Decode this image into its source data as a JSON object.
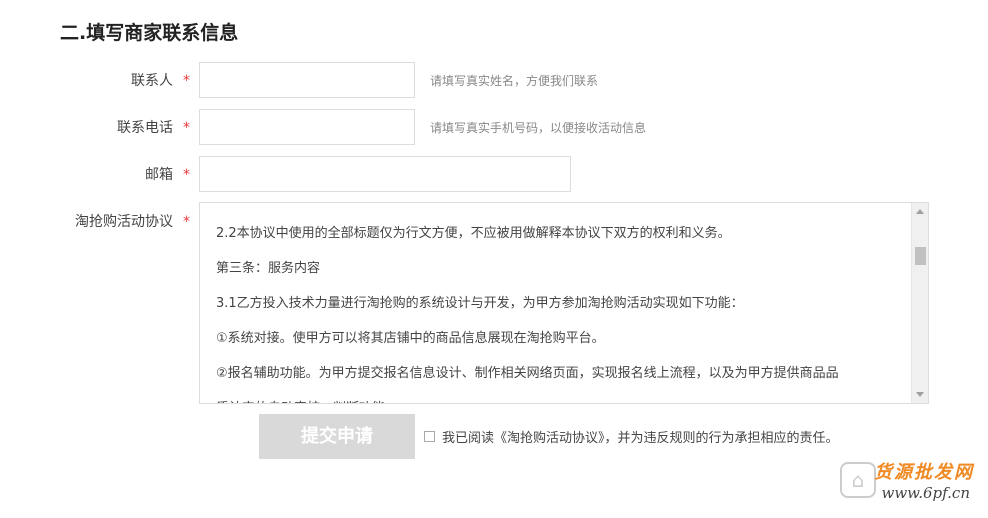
{
  "section": {
    "title": "二.填写商家联系信息"
  },
  "fields": {
    "contact": {
      "label": "联系人",
      "required": "*",
      "value": "",
      "placeholder": "",
      "hint": "请填写真实姓名，方便我们联系"
    },
    "phone": {
      "label": "联系电话",
      "required": "*",
      "value": "",
      "placeholder": "",
      "hint": "请填写真实手机号码，以便接收活动信息"
    },
    "email": {
      "label": "邮箱",
      "required": "*",
      "value": "",
      "placeholder": ""
    },
    "agreement": {
      "label": "淘抢购活动协议",
      "required": "*",
      "paragraphs": [
        "2.2本协议中使用的全部标题仅为行文方便，不应被用做解释本协议下双方的权利和义务。",
        "第三条：服务内容",
        "3.1乙方投入技术力量进行淘抢购的系统设计与开发，为甲方参加淘抢购活动实现如下功能：",
        "①系统对接。使甲方可以将其店铺中的商品信息展现在淘抢购平台。",
        "②报名辅助功能。为甲方提交报名信息设计、制作相关网络页面，实现报名线上流程，以及为甲方提供商品品",
        "质认定的自动审核、判断功能。"
      ]
    }
  },
  "actions": {
    "submit_label": "提交申请",
    "consent_text": "我已阅读《淘抢购活动协议》，并为违反规则的行为承担相应的责任。"
  },
  "watermark": {
    "brand": "货源批发网",
    "url": "www.6pf.cn",
    "mark": "⌂"
  },
  "colors": {
    "required": "#e4393c",
    "button_disabled": "#d9d9d9",
    "watermark": "#f08a24"
  }
}
